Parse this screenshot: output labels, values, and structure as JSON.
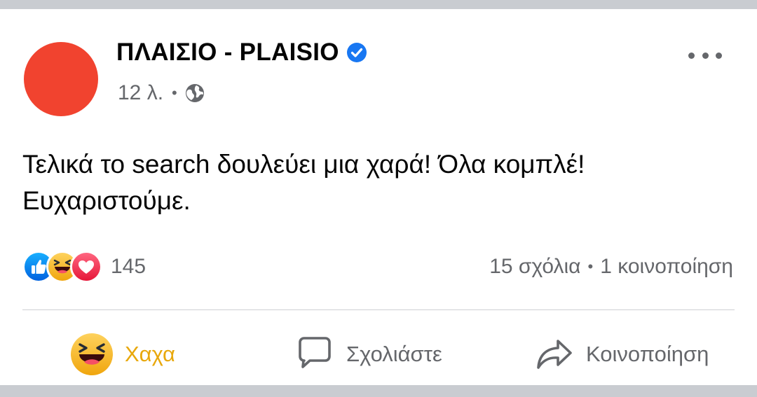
{
  "post": {
    "page_name": "ΠΛΑΙΣΙΟ - PLAISIO",
    "time": "12 λ.",
    "separator": "•",
    "text_lines": [
      "Τελικά το search δουλεύει μια χαρά! Όλα κομπλέ!",
      "Ευχαριστούμε."
    ],
    "avatar_color": "#f1432f"
  },
  "reactions": {
    "types": [
      "like",
      "haha",
      "love"
    ],
    "count": "145"
  },
  "stats": {
    "comments": "15 σχόλια",
    "separator": "•",
    "shares": "1 κοινοποίηση"
  },
  "actions": {
    "react_label": "Χαχα",
    "comment_label": "Σχολιάστε",
    "share_label": "Κοινοποίηση"
  },
  "colors": {
    "verified": "#1877f2",
    "haha_active": "#e8a80c",
    "secondary_text": "#65676b"
  }
}
